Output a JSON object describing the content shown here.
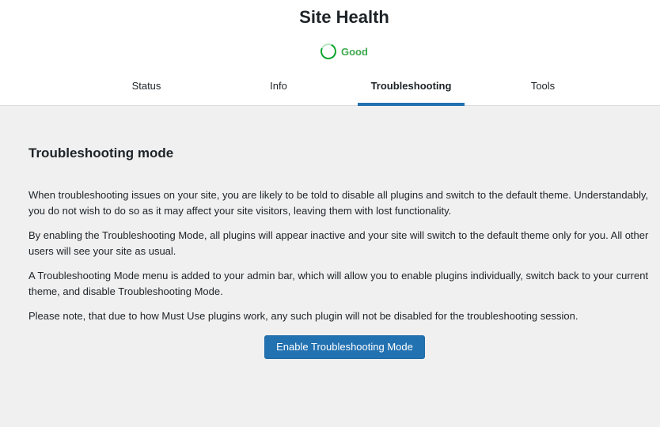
{
  "header": {
    "title": "Site Health",
    "status": {
      "icon": "progress-ring-icon",
      "label": "Good",
      "color": "#00a32a"
    }
  },
  "tabs": [
    {
      "label": "Status",
      "active": false
    },
    {
      "label": "Info",
      "active": false
    },
    {
      "label": "Troubleshooting",
      "active": true
    },
    {
      "label": "Tools",
      "active": false
    }
  ],
  "main": {
    "heading": "Troubleshooting mode",
    "paragraphs": [
      "When troubleshooting issues on your site, you are likely to be told to disable all plugins and switch to the default theme. Understandably, you do not wish to do so as it may affect your site visitors, leaving them with lost functionality.",
      "By enabling the Troubleshooting Mode, all plugins will appear inactive and your site will switch to the default theme only for you. All other users will see your site as usual.",
      "A Troubleshooting Mode menu is added to your admin bar, which will allow you to enable plugins individually, switch back to your current theme, and disable Troubleshooting Mode.",
      "Please note, that due to how Must Use plugins work, any such plugin will not be disabled for the troubleshooting session."
    ],
    "button_label": "Enable Troubleshooting Mode"
  },
  "colors": {
    "accent": "#2271b1",
    "good": "#00a32a"
  }
}
